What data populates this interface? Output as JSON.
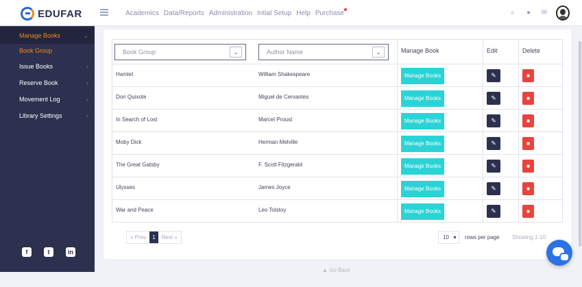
{
  "brand": {
    "name": "EDUFAR"
  },
  "topnav": [
    "Academics",
    "Data/Reports",
    "Administration",
    "Intial Setup",
    "Help",
    "Purchase"
  ],
  "sidebar": {
    "items": [
      {
        "label": "Manage Books",
        "chev": "⌄"
      },
      {
        "label": "Book Group"
      },
      {
        "label": "Issue Books",
        "chev": "›"
      },
      {
        "label": "Reserve Book",
        "chev": "›"
      },
      {
        "label": "Movement Log",
        "chev": "›"
      },
      {
        "label": "Library Settings",
        "chev": "›"
      }
    ],
    "social": [
      "f",
      "t",
      "in"
    ]
  },
  "table": {
    "filters": {
      "book_group": "Book Group",
      "author_name": "Author Name"
    },
    "headers": {
      "manage": "Manage Book",
      "edit": "Edit",
      "delete": "Delete"
    },
    "button_label": "Manage Books",
    "rows": [
      {
        "title": "Hamlet",
        "author": "William Shakespeare"
      },
      {
        "title": "Don Quixote",
        "author": "Miguel de Cervantes"
      },
      {
        "title": "In Search of Lost",
        "author": "Marcel Proust"
      },
      {
        "title": "Moby Dick",
        "author": "Herman Melville"
      },
      {
        "title": "The Great Gatsby",
        "author": "F. Scott Fitzgerald"
      },
      {
        "title": "Ulysses",
        "author": "James Joyce"
      },
      {
        "title": "War and Peace",
        "author": "Leo Tolstoy"
      }
    ]
  },
  "pagination": {
    "prev": "« Prev",
    "current": "1",
    "next": "Next »"
  },
  "rows_per_page": {
    "value": "10",
    "label": "rows per page"
  },
  "showing": "Showing 1-10",
  "go_back": "Go Back"
}
